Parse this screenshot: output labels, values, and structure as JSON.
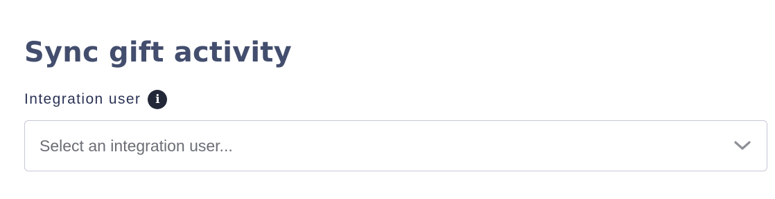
{
  "section": {
    "title": "Sync gift activity"
  },
  "integration_user": {
    "label": "Integration user",
    "info_icon": "info-icon",
    "info_glyph": "i",
    "placeholder": "Select an integration user...",
    "dropdown_icon": "chevron-down-icon"
  },
  "colors": {
    "title": "#434e6e",
    "label": "#2b3355",
    "info_icon_bg": "#232838",
    "select_border": "#c6c9d6",
    "placeholder": "#6b6e75",
    "chevron": "#8e9097"
  }
}
